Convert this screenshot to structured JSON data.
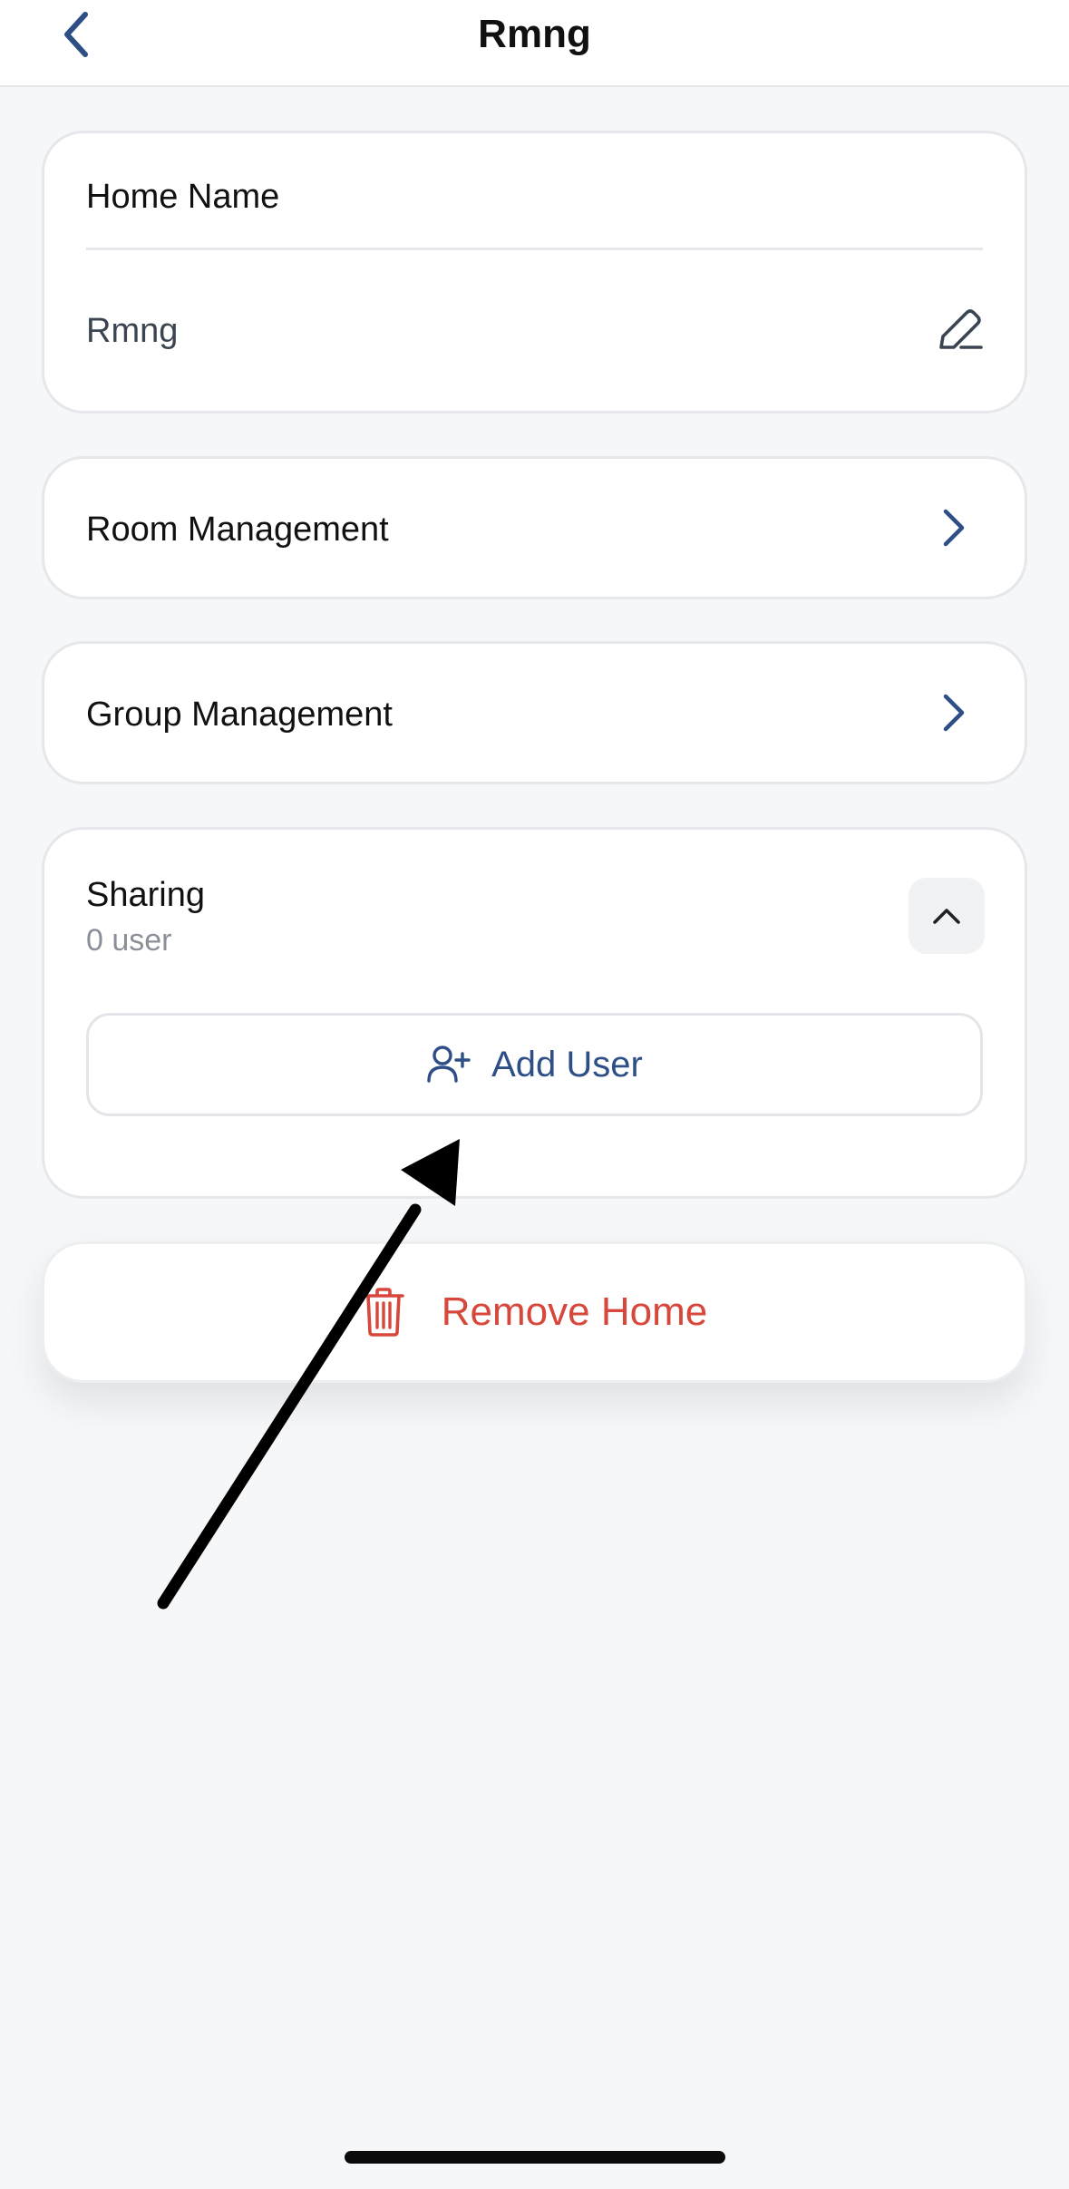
{
  "header": {
    "title": "Rmng",
    "back_icon": "chevron-left-icon"
  },
  "home_name": {
    "label": "Home Name",
    "value": "Rmng",
    "edit_icon": "pencil-icon"
  },
  "room_management": {
    "label": "Room Management",
    "icon": "chevron-right-icon"
  },
  "group_management": {
    "label": "Group Management",
    "icon": "chevron-right-icon"
  },
  "sharing": {
    "title": "Sharing",
    "count": "0 user",
    "collapse_icon": "chevron-up-icon",
    "add_user_label": "Add User",
    "add_user_icon": "user-plus-icon"
  },
  "remove_home": {
    "label": "Remove Home",
    "icon": "trash-icon"
  },
  "colors": {
    "accent": "#2e4f86",
    "danger": "#d7473b",
    "background": "#f6f7f9",
    "card": "#ffffff"
  }
}
